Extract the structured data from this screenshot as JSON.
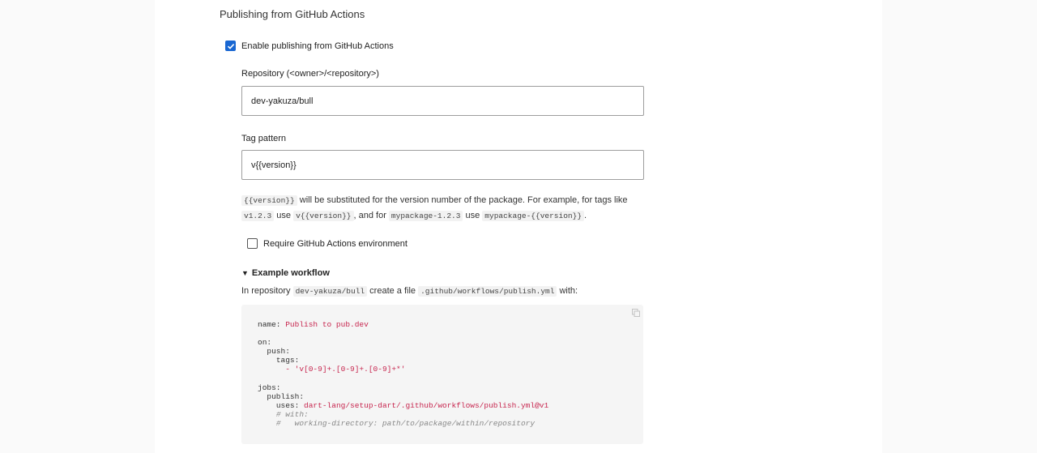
{
  "section": {
    "title": "Publishing from GitHub Actions"
  },
  "enable": {
    "label": "Enable publishing from GitHub Actions",
    "checked": true
  },
  "repository": {
    "label": "Repository (<owner>/<repository>)",
    "value": "dev-yakuza/bull"
  },
  "tag_pattern": {
    "label": "Tag pattern",
    "value": "v{{version}}"
  },
  "help": {
    "code1": "{{version}}",
    "text1": " will be substituted for the version number of the package. For example, for tags like ",
    "code2": "v1.2.3",
    "text2": " use ",
    "code3": "v{{version}}",
    "text3": ", and for ",
    "code4": "mypackage-1.2.3",
    "text4": " use ",
    "code5": "mypackage-{{version}}",
    "text5": "."
  },
  "require_env": {
    "label": "Require GitHub Actions environment",
    "checked": false
  },
  "example": {
    "summary": "Example workflow",
    "intro_prefix": "In repository ",
    "intro_repo": "dev-yakuza/bull",
    "intro_mid": " create a file ",
    "intro_file": ".github/workflows/publish.yml",
    "intro_suffix": " with:"
  },
  "code": {
    "name_key": "name:",
    "name_val": "Publish to pub.dev",
    "on_key": "on:",
    "push_key": "push:",
    "tags_key": "tags:",
    "tags_val": "- 'v[0-9]+.[0-9]+.[0-9]+*'",
    "jobs_key": "jobs:",
    "publish_key": "publish:",
    "uses_key": "uses:",
    "uses_val": "dart-lang/setup-dart/.github/workflows/publish.yml@v1",
    "comment1": "# with:",
    "comment2": "#   working-directory: path/to/package/within/repository"
  },
  "icons": {
    "checkbox_check": "check-icon",
    "copy": "copy-icon",
    "triangle": "triangle-down-icon"
  },
  "colors": {
    "accent": "#1967d2",
    "code_string": "#c7254e",
    "code_comment": "#888888"
  }
}
